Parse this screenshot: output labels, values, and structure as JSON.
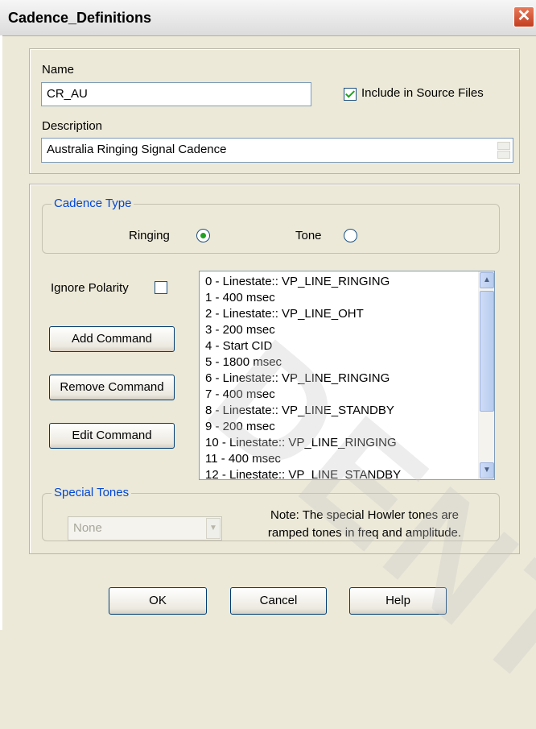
{
  "window": {
    "title": "Cadence_Definitions",
    "close_label": "✕"
  },
  "name_section": {
    "name_label": "Name",
    "name_value": "CR_AU",
    "include_label": "Include in Source Files",
    "include_checked": true,
    "description_label": "Description",
    "description_value": "Australia Ringing Signal Cadence"
  },
  "cadence_type": {
    "legend": "Cadence Type",
    "options": [
      {
        "label": "Ringing",
        "selected": true
      },
      {
        "label": "Tone",
        "selected": false
      }
    ]
  },
  "ignore_polarity": {
    "label": "Ignore Polarity",
    "checked": false
  },
  "buttons": {
    "add": "Add Command",
    "remove": "Remove Command",
    "edit": "Edit Command"
  },
  "commands": [
    "0 - Linestate:: VP_LINE_RINGING",
    "1 - 400 msec",
    "2 - Linestate:: VP_LINE_OHT",
    "3 - 200 msec",
    "4 - Start CID",
    "5 - 1800 msec",
    "6 - Linestate:: VP_LINE_RINGING",
    "7 - 400 msec",
    "8 - Linestate:: VP_LINE_STANDBY",
    "9 - 200 msec",
    "10 - Linestate:: VP_LINE_RINGING",
    "11 - 400 msec",
    "12 - Linestate:: VP_LINE_STANDBY"
  ],
  "special_tones": {
    "legend": "Special Tones",
    "select_value": "None",
    "note_line1": "Note: The special Howler tones are",
    "note_line2": "ramped tones in freq and amplitude."
  },
  "footer": {
    "ok": "OK",
    "cancel": "Cancel",
    "help": "Help"
  }
}
